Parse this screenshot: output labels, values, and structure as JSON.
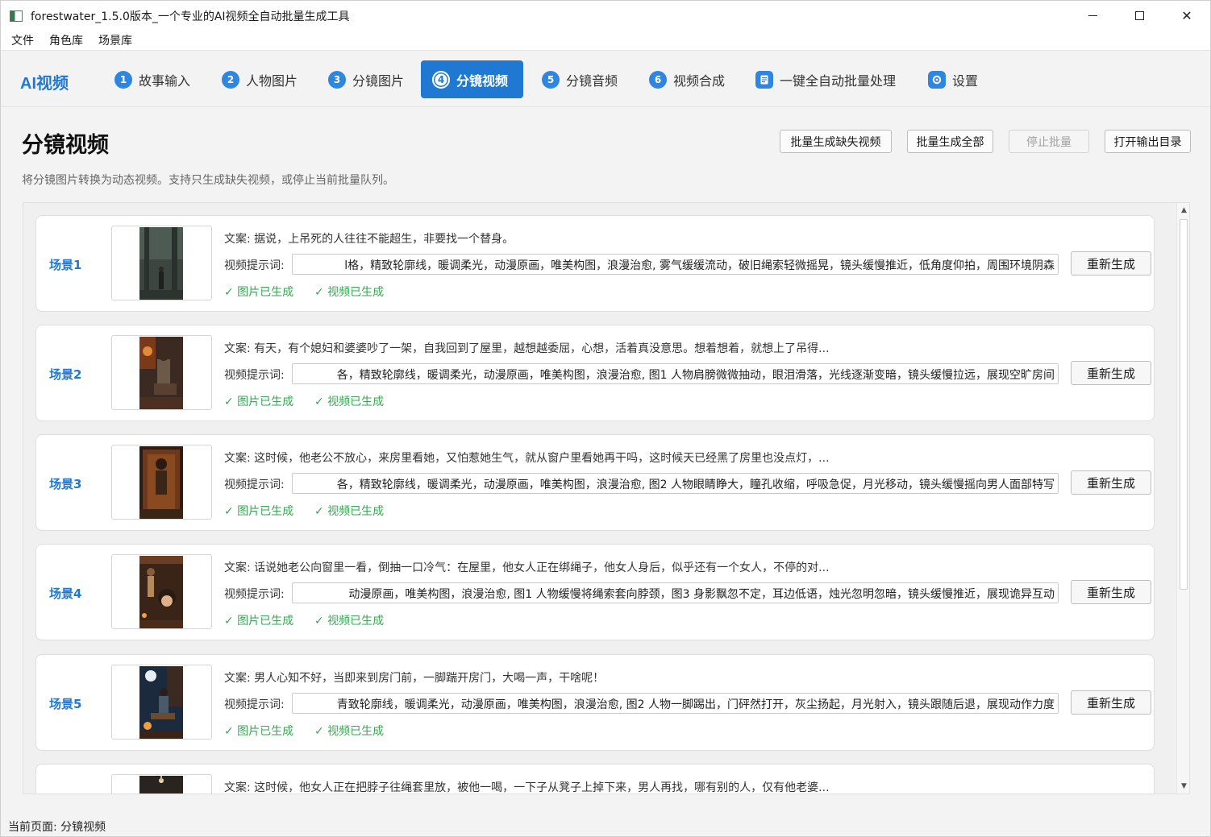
{
  "window": {
    "title": "forestwater_1.5.0版本_一个专业的AI视频全自动批量生成工具"
  },
  "menu": [
    "文件",
    "角色库",
    "场景库"
  ],
  "nav": {
    "brand": "AI视频",
    "tabs": [
      {
        "num": "1",
        "label": "故事输入"
      },
      {
        "num": "2",
        "label": "人物图片"
      },
      {
        "num": "3",
        "label": "分镜图片"
      },
      {
        "num": "4",
        "label": "分镜视频"
      },
      {
        "num": "5",
        "label": "分镜音频"
      },
      {
        "num": "6",
        "label": "视频合成"
      },
      {
        "num": "",
        "label": "一键全自动批量处理"
      },
      {
        "num": "",
        "label": "设置"
      }
    ],
    "active_tab": "分镜视频",
    "accent_color": "#1f78d1"
  },
  "header": {
    "title": "分镜视频",
    "description": "将分镜图片转换为动态视频。支持只生成缺失视频，或停止当前批量队列。",
    "buttons": {
      "generate_missing": "批量生成缺失视频",
      "generate_all": "批量生成全部",
      "stop_batch": "停止批量",
      "open_output": "打开输出目录"
    }
  },
  "scenes": [
    {
      "label": "场景1",
      "copy": "文案: 据说，上吊死的人往往不能超生，非要找一个替身。",
      "prompt_label": "视频提示词:",
      "prompt": "l格，精致轮廓线，暖调柔光，动漫原画，唯美构图，浪漫治愈, 雾气缓缓流动，破旧绳索轻微摇晃，镜头缓慢推近，低角度仰拍，周围环境阴森",
      "image_status": "✓ 图片已生成",
      "video_status": "✓ 视频已生成",
      "regen": "重新生成"
    },
    {
      "label": "场景2",
      "copy": "文案: 有天，有个媳妇和婆婆吵了一架，自我回到了屋里，越想越委屈，心想，活着真没意思。想着想着，就想上了吊得...",
      "prompt_label": "视频提示词:",
      "prompt": "各，精致轮廓线，暖调柔光，动漫原画，唯美构图，浪漫治愈, 图1 人物肩膀微微抽动，眼泪滑落，光线逐渐变暗，镜头缓慢拉远，展现空旷房间",
      "image_status": "✓ 图片已生成",
      "video_status": "✓ 视频已生成",
      "regen": "重新生成"
    },
    {
      "label": "场景3",
      "copy": "文案: 这时候，他老公不放心，来房里看她，又怕惹她生气，就从窗户里看她再干吗，这时候天已经黑了房里也没点灯，...",
      "prompt_label": "视频提示词:",
      "prompt": "各，精致轮廓线，暖调柔光，动漫原画，唯美构图，浪漫治愈, 图2 人物眼睛睁大，瞳孔收缩，呼吸急促，月光移动，镜头缓慢摇向男人面部特写",
      "image_status": "✓ 图片已生成",
      "video_status": "✓ 视频已生成",
      "regen": "重新生成"
    },
    {
      "label": "场景4",
      "copy": "文案: 话说她老公向窗里一看，倒抽一口冷气：在屋里，他女人正在绑绳子，他女人身后，似乎还有一个女人，不停的对...",
      "prompt_label": "视频提示词:",
      "prompt": "动漫原画，唯美构图，浪漫治愈, 图1 人物缓慢将绳索套向脖颈，图3 身影飘忽不定，耳边低语，烛光忽明忽暗，镜头缓慢推近，展现诡异互动",
      "image_status": "✓ 图片已生成",
      "video_status": "✓ 视频已生成",
      "regen": "重新生成"
    },
    {
      "label": "场景5",
      "copy": "文案: 男人心知不好，当即来到房门前，一脚踹开房门，大喝一声，干啥呢！",
      "prompt_label": "视频提示词:",
      "prompt": "青致轮廓线，暖调柔光，动漫原画，唯美构图，浪漫治愈, 图2 人物一脚踢出，门砰然打开，灰尘扬起，月光射入，镜头跟随后退，展现动作力度",
      "image_status": "✓ 图片已生成",
      "video_status": "✓ 视频已生成",
      "regen": "重新生成"
    },
    {
      "label": "",
      "copy": "文案: 这时候，他女人正在把脖子往绳套里放，被他一喝，一下子从凳子上掉下来，男人再找，哪有别的人，仅有他老婆...",
      "prompt_label": "",
      "prompt": "",
      "image_status": "",
      "video_status": "",
      "regen": ""
    }
  ],
  "statusbar": {
    "text": "当前页面: 分镜视频"
  },
  "colors": {
    "link": "#1f78d1",
    "success": "#3aa655"
  }
}
